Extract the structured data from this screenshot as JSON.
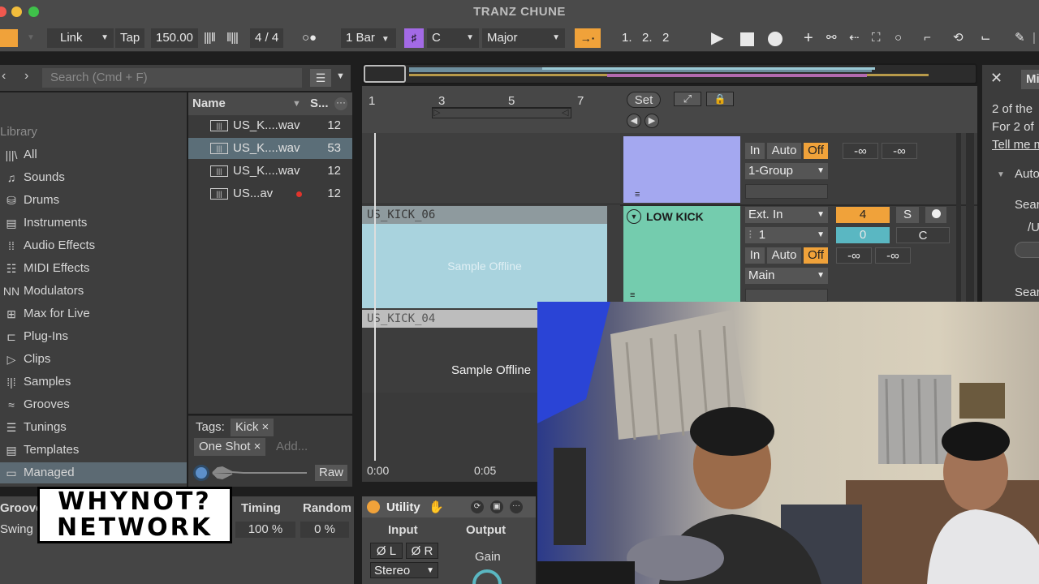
{
  "window": {
    "title": "TRANZ CHUNE"
  },
  "transport": {
    "link": "Link",
    "tap": "Tap",
    "tempo": "150.00",
    "time_signature": "4 / 4",
    "quantize": "1 Bar",
    "key": "C",
    "scale": "Major",
    "position": "1.   2.   2"
  },
  "browser": {
    "search_placeholder": "Search (Cmd + F)",
    "library_label": "Library",
    "categories": [
      "All",
      "Sounds",
      "Drums",
      "Instruments",
      "Audio Effects",
      "MIDI Effects",
      "Modulators",
      "Max for Live",
      "Plug-Ins",
      "Clips",
      "Samples",
      "Grooves",
      "Tunings",
      "Templates",
      "Managed"
    ],
    "columns": {
      "name": "Name",
      "size": "S..."
    },
    "files": [
      {
        "name": "US_K....wav",
        "size": "12"
      },
      {
        "name": "US_K....wav",
        "size": "53"
      },
      {
        "name": "US_K....wav",
        "size": "12"
      },
      {
        "name": "US...av",
        "size": "12"
      }
    ],
    "tags_label": "Tags:",
    "tags": [
      "Kick",
      "One Shot"
    ],
    "add_tag": "Add...",
    "preview_mode": "Raw"
  },
  "groove": {
    "header": [
      "Groove",
      "Timing",
      "Random"
    ],
    "row": {
      "name": "Swing",
      "timing": "100 %",
      "random": "0 %"
    }
  },
  "arrangement": {
    "ruler": [
      "1",
      "3",
      "5",
      "7"
    ],
    "set_button": "Set",
    "clips": [
      {
        "name": "US_KICK_06",
        "status": "Sample Offline"
      },
      {
        "name": "US_KICK_04",
        "status": "Sample Offline"
      }
    ],
    "time_ruler": [
      "0:00",
      "0:05"
    ]
  },
  "mixer": {
    "track1": {
      "in": "In",
      "auto": "Auto",
      "off": "Off",
      "vol_a": "-∞",
      "vol_b": "-∞",
      "group": "1-Group"
    },
    "track2": {
      "name": "LOW KICK",
      "input": "Ext. In",
      "channel": "1",
      "in": "In",
      "auto": "Auto",
      "off": "Off",
      "track_number": "4",
      "solo": "S",
      "volume": "0",
      "pan": "C",
      "vol_a": "-∞",
      "vol_b": "-∞",
      "output": "Main"
    }
  },
  "info_panel": {
    "line1": "2 of the",
    "line2": "For 2 of",
    "link": "Tell me m",
    "section": "Auto",
    "search_a": "Sear",
    "path": "/U",
    "search_b": "Sear",
    "tab": "Mi"
  },
  "device": {
    "name": "Utility",
    "input_label": "Input",
    "output_label": "Output",
    "phase_l": "Ø L",
    "phase_r": "Ø R",
    "channel_mode": "Stereo",
    "gain_label": "Gain"
  },
  "logo": {
    "line1": "WHYNOT?",
    "line2": "NETWORK"
  },
  "colors": {
    "accent_orange": "#f0a23a",
    "clip_blue": "#a9d3de",
    "track_purple": "#a4a8f0",
    "track_green": "#74ccae",
    "key_purple": "#a36ae6",
    "volume_cyan": "#5ab7c2"
  }
}
